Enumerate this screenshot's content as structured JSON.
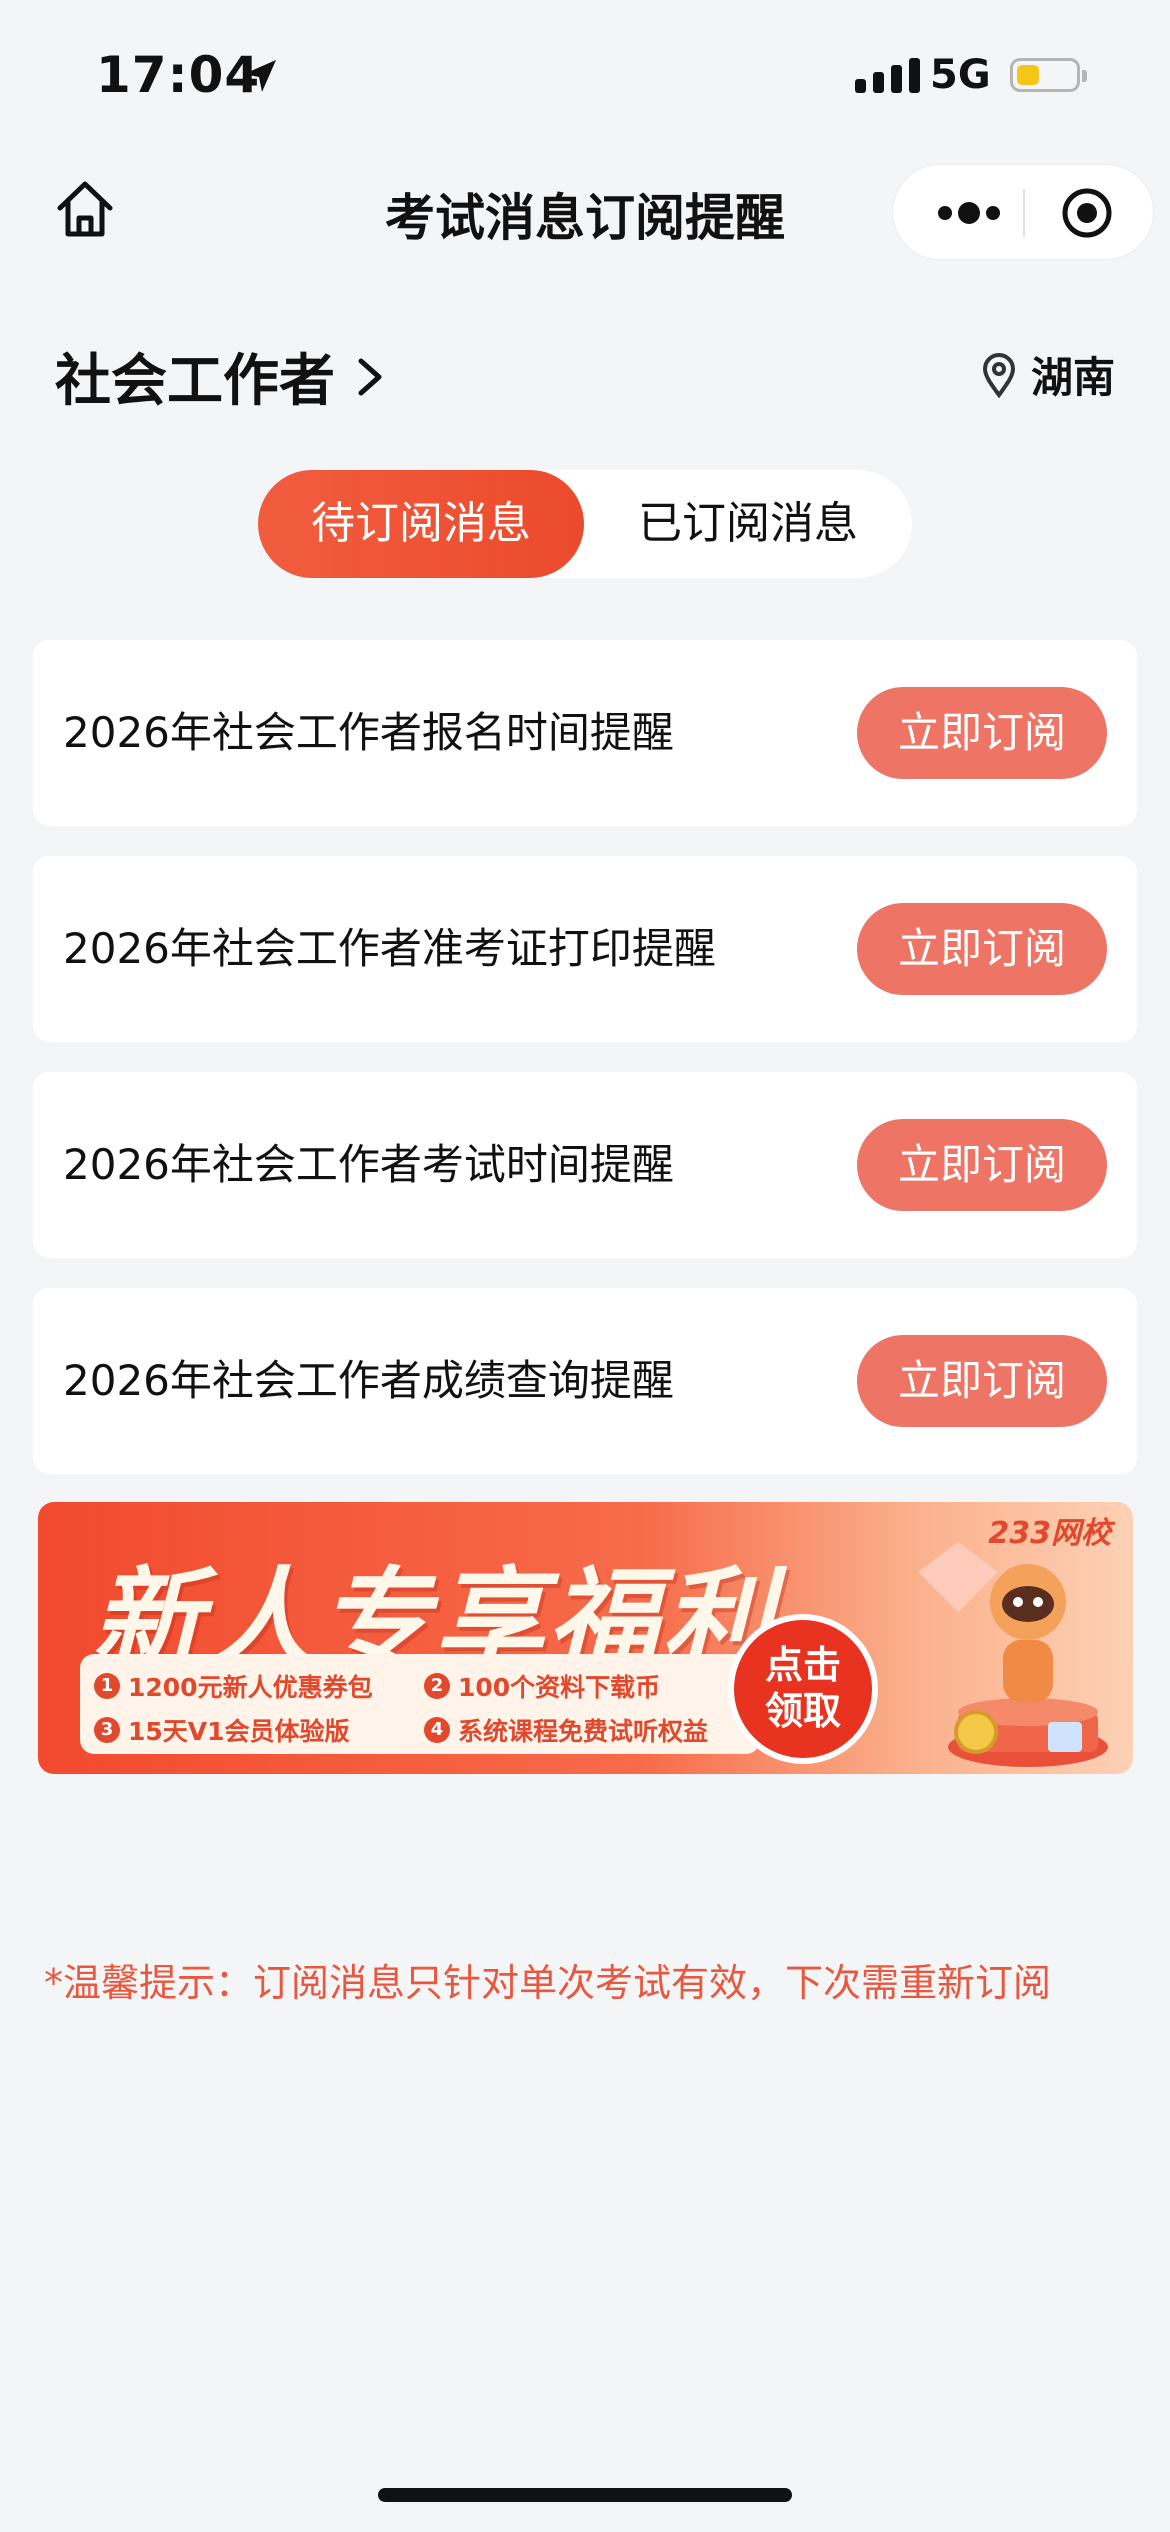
{
  "status_bar": {
    "time": "17:04",
    "network": "5G",
    "battery_level": 0.35
  },
  "nav": {
    "title": "考试消息订阅提醒",
    "home_icon": "home-icon",
    "more_icon": "more-dots-icon",
    "close_icon": "target-circle-icon"
  },
  "header": {
    "exam_name": "社会工作者",
    "region": "湖南"
  },
  "tabs": [
    {
      "label": "待订阅消息",
      "active": true
    },
    {
      "label": "已订阅消息",
      "active": false
    }
  ],
  "reminders": [
    {
      "title": "2026年社会工作者报名时间提醒",
      "button": "立即订阅"
    },
    {
      "title": "2026年社会工作者准考证打印提醒",
      "button": "立即订阅"
    },
    {
      "title": "2026年社会工作者考试时间提醒",
      "button": "立即订阅"
    },
    {
      "title": "2026年社会工作者成绩查询提醒",
      "button": "立即订阅"
    }
  ],
  "banner": {
    "title": "新人专享福利",
    "brand": "233网校",
    "perks": [
      "1200元新人优惠券包",
      "100个资料下载币",
      "15天V1会员体验版",
      "系统课程免费试听权益"
    ],
    "cta_line1": "点击",
    "cta_line2": "领取"
  },
  "tip": "*温馨提示：订阅消息只针对单次考试有效，下次需重新订阅",
  "colors": {
    "accent": "#ec4a2c",
    "button": "#ee7566",
    "tip": "#e9583e",
    "background": "#f4f5f7"
  }
}
